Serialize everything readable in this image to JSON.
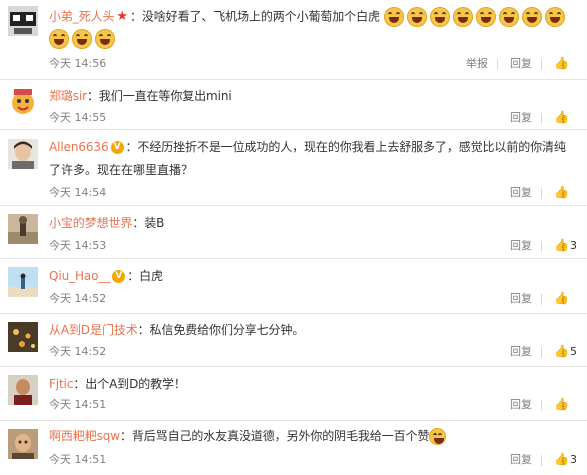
{
  "labels": {
    "report": "举报",
    "reply": "回复"
  },
  "comments": [
    {
      "user": "小弟_死人头",
      "text": "：没啥好看了、飞机场上的两个小葡萄加个白虎",
      "time": "今天 14:56",
      "likes": "",
      "badge": "star-icon"
    },
    {
      "user": "郑璐sir",
      "text": "：我们一直在等你复出mini",
      "time": "今天 14:55",
      "likes": ""
    },
    {
      "user": "Allen6636",
      "text": "：不经历挫折不是一位成功的人，现在的你我看上去舒服多了，感觉比以前的你清纯",
      "text2": "了许多。现在在哪里直播？",
      "time": "今天 14:54",
      "likes": "",
      "badge": "v-badge-icon"
    },
    {
      "user": "小宝的梦想世界",
      "text": "：装B",
      "time": "今天 14:53",
      "likes": "3"
    },
    {
      "user": "Qiu_Hao__",
      "text": "：白虎",
      "time": "今天 14:52",
      "likes": "",
      "badge": "v-badge-icon"
    },
    {
      "user": "从A到D是门技术",
      "text": "：私信免费给你们分享七分钟。",
      "time": "今天 14:52",
      "likes": "5"
    },
    {
      "user": "Fjtic",
      "text": "：出个A到D的教学！",
      "time": "今天 14:51",
      "likes": ""
    },
    {
      "user": "啊西粑粑sqw",
      "text": "：背后骂自己的水友真没道德，另外你的阴毛我给一百个赞",
      "time": "今天 14:51",
      "likes": "3"
    }
  ]
}
